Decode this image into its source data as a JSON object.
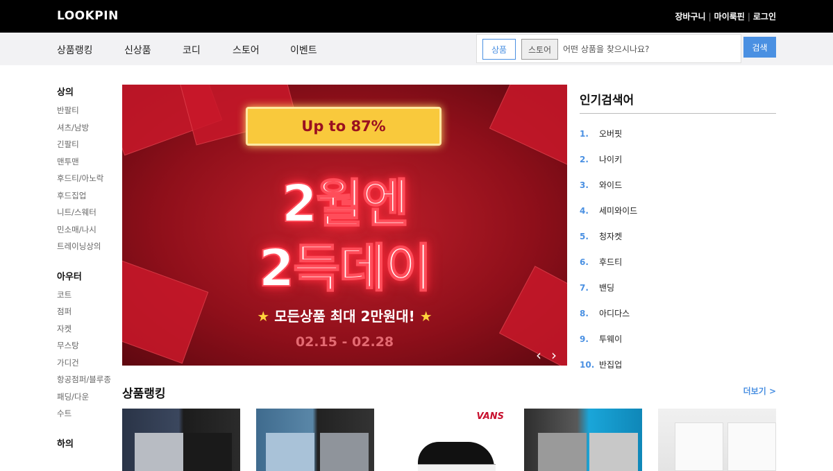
{
  "header": {
    "logo": "LOOKPIN",
    "links": [
      "장바구니",
      "마이룩핀",
      "로그인"
    ]
  },
  "nav": {
    "items": [
      "상품랭킹",
      "신상품",
      "코디",
      "스토어",
      "이벤트"
    ],
    "search": {
      "scope_active": "상품",
      "scope_inactive": "스토어",
      "placeholder": "어떤 상품을 찾으시나요?",
      "button": "검색"
    }
  },
  "sidebar": {
    "groups": [
      {
        "title": "상의",
        "items": [
          "반팔티",
          "셔츠/남방",
          "긴팔티",
          "맨투맨",
          "후드티/아노락",
          "후드집업",
          "니트/스웨터",
          "민소매/나시",
          "트레이닝상의"
        ]
      },
      {
        "title": "아우터",
        "items": [
          "코트",
          "점퍼",
          "자켓",
          "무스탕",
          "가디건",
          "항공점퍼/블루종",
          "패딩/다운",
          "수트"
        ]
      },
      {
        "title": "하의",
        "items": []
      }
    ]
  },
  "banner": {
    "badge": "Up to 87%",
    "line1": "2월엔",
    "line2": "2득데이",
    "subline": "모든상품 최대 2만원대!",
    "dates": "02.15 - 02.28",
    "prev": "‹",
    "next": "›"
  },
  "popular": {
    "title": "인기검색어",
    "items": [
      {
        "rank": "1.",
        "term": "오버핏"
      },
      {
        "rank": "2.",
        "term": "나이키"
      },
      {
        "rank": "3.",
        "term": "와이드"
      },
      {
        "rank": "4.",
        "term": "세미와이드"
      },
      {
        "rank": "5.",
        "term": "청자켓"
      },
      {
        "rank": "6.",
        "term": "후드티"
      },
      {
        "rank": "7.",
        "term": "밴딩"
      },
      {
        "rank": "8.",
        "term": "아디다스"
      },
      {
        "rank": "9.",
        "term": "투웨이"
      },
      {
        "rank": "10.",
        "term": "반집업"
      }
    ]
  },
  "ranking": {
    "title": "상품랭킹",
    "more": "더보기 >",
    "vans_logo": "VANS"
  },
  "colors": {
    "accent": "#4a90e2",
    "topbar": "#000000",
    "navbar": "#f2f2f4"
  }
}
